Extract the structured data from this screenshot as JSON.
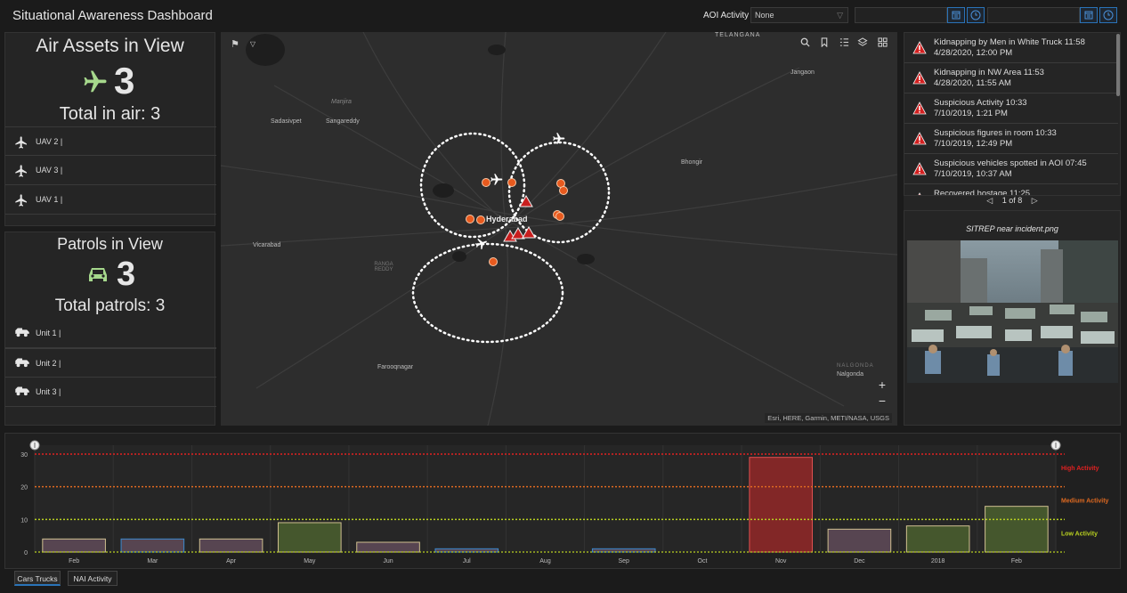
{
  "header": {
    "title": "Situational Awareness Dashboard",
    "aoi_label": "AOI Activity",
    "aoi_value": "None"
  },
  "air": {
    "title": "Air Assets in View",
    "count": "3",
    "total": "Total in air: 3",
    "items": [
      "UAV 2 |",
      "UAV 3 |",
      "UAV 1 |"
    ]
  },
  "patrols": {
    "title": "Patrols in View",
    "count": "3",
    "total": "Total patrols: 3",
    "items": [
      "Unit 1 |",
      "Unit 2 |",
      "Unit 3 |"
    ]
  },
  "map": {
    "places": [
      "TELANGANA",
      "Jangaon",
      "Sadasivpet",
      "Sangareddy",
      "Manjira",
      "Bhongir",
      "Hyderabad",
      "Vicarabad",
      "RANGA REDDY",
      "Farooqnagar",
      "NALGONDA",
      "Nalgonda"
    ],
    "attribution": "Esri, HERE, Garmin, METI/NASA, USGS",
    "zoom_in": "+",
    "zoom_out": "−"
  },
  "incidents": {
    "items": [
      {
        "title": "Kidnapping by Men in White Truck 11:58",
        "date": "4/28/2020, 12:00 PM"
      },
      {
        "title": "Kidnapping in NW Area 11:53",
        "date": "4/28/2020, 11:55 AM"
      },
      {
        "title": "Suspicious Activity 10:33",
        "date": "7/10/2019, 1:21 PM"
      },
      {
        "title": "Suspicious figures in room 10:33",
        "date": "7/10/2019, 12:49 PM"
      },
      {
        "title": "Suspicious vehicles spotted in AOI 07:45",
        "date": "7/10/2019, 10:37 AM"
      },
      {
        "title": "Recovered hostage 11:25",
        "date": ""
      }
    ],
    "pager": "1 of 8",
    "prev": "◁",
    "next": "▷"
  },
  "attachment": {
    "title": "SITREP near incident.png"
  },
  "chart_data": {
    "type": "bar",
    "categories": [
      "Feb",
      "Mar",
      "Apr",
      "May",
      "Jun",
      "Jul",
      "Aug",
      "Sep",
      "Oct",
      "Nov",
      "Dec",
      "2018",
      "Feb"
    ],
    "values": [
      4,
      4,
      4,
      9,
      3,
      1,
      0,
      1,
      0,
      29,
      7,
      8,
      14
    ],
    "ylim": [
      0,
      30
    ],
    "yticks": [
      0,
      10,
      20,
      30
    ],
    "thresholds": [
      {
        "label": "High Activity",
        "value": 30,
        "color": "#e02020"
      },
      {
        "label": "Medium Activity",
        "value": 20,
        "color": "#e06a20"
      },
      {
        "label": "Low Activity",
        "value": 10,
        "color": "#b8d020"
      }
    ],
    "grid": true
  },
  "tabs": [
    "Cars Trucks",
    "NAI Activity"
  ],
  "colors": {
    "accent": "#2a73b8",
    "alert": "#d42020",
    "bg": "#1b1b1b",
    "panel": "#252525"
  }
}
